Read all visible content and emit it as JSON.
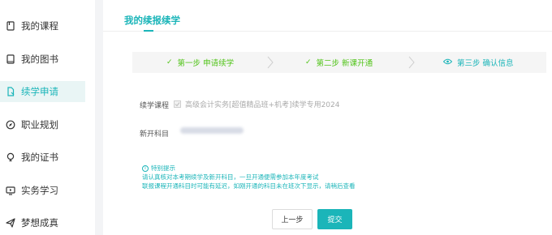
{
  "sidebar": {
    "items": [
      {
        "label": "我的课程",
        "icon": "book-icon",
        "active": false
      },
      {
        "label": "我的图书",
        "icon": "book-2-icon",
        "active": false
      },
      {
        "label": "续学申请",
        "icon": "document-icon",
        "active": true
      },
      {
        "label": "职业规划",
        "icon": "compass-icon",
        "active": false
      },
      {
        "label": "我的证书",
        "icon": "lightbulb-icon",
        "active": false
      },
      {
        "label": "实务学习",
        "icon": "monitor-icon",
        "active": false
      },
      {
        "label": "梦想成真",
        "icon": "paper-plane-icon",
        "active": false
      }
    ]
  },
  "main": {
    "title": "我的续报续学",
    "steps": [
      {
        "mark": "✓",
        "label": "第一步 申请续学",
        "status": "done"
      },
      {
        "mark": "✓",
        "label": "第二步 新课开通",
        "status": "done"
      },
      {
        "mark": "eye-icon",
        "label": "第三步 确认信息",
        "status": "current"
      }
    ],
    "form": {
      "course_label": "续学课程",
      "course_value": "高级会计实务[超值精品班+机考]续学专用2024",
      "subject_label": "新开科目"
    },
    "notice": {
      "title": "特别提示",
      "lines": [
        "请认真核对本考期续学及新开科目，一旦开通便需参加本年度考试",
        "联报课程开通科目时可能有延迟，如刚开通的科目未在班次下显示，请稍后查看"
      ]
    },
    "buttons": {
      "prev": "上一步",
      "submit": "提交"
    }
  },
  "colors": {
    "accent": "#1bb5b9",
    "done": "#52c41a",
    "active_bg": "#e9f5f5",
    "page_bg": "#f3f4f6"
  }
}
